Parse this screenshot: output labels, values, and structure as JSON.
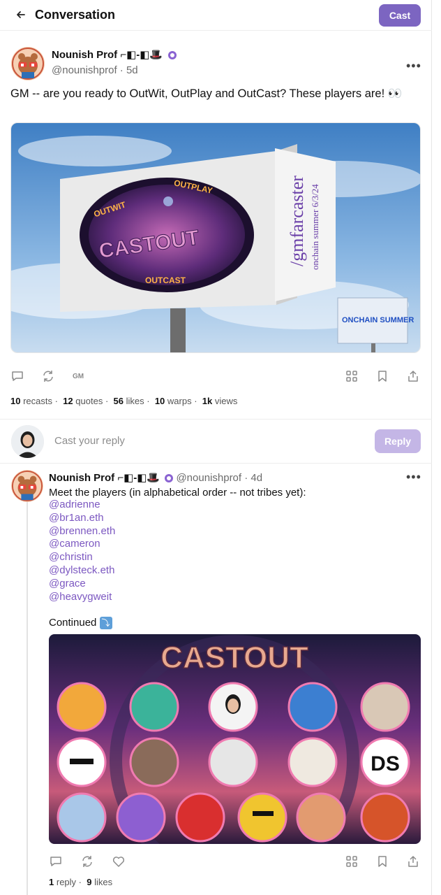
{
  "header": {
    "title": "Conversation",
    "cast_label": "Cast"
  },
  "cast": {
    "author": "Nounish Prof ⌐◧-◧🎩",
    "handle": "@nounishprof",
    "time": "5d",
    "text": "GM -- are you ready to OutWit, OutPlay and OutCast? These players are! 👀",
    "image": {
      "ellipse_words": [
        "OUTWIT",
        "OUTPLAY",
        "CASTOUT",
        "OUTCAST"
      ],
      "side_text": "/gmfarcaster",
      "side_subtext": "onchain summer 6/3/24",
      "small_billboard_text": "ONCHAIN SUMMER"
    },
    "gm_label": "GM",
    "stats": [
      {
        "value": "10",
        "label": "recasts"
      },
      {
        "value": "12",
        "label": "quotes"
      },
      {
        "value": "56",
        "label": "likes"
      },
      {
        "value": "10",
        "label": "warps"
      },
      {
        "value": "1k",
        "label": "views"
      }
    ]
  },
  "reply_box": {
    "placeholder": "Cast your reply",
    "button": "Reply"
  },
  "reply": {
    "author": "Nounish Prof ⌐◧-◧🎩",
    "handle": "@nounishprof",
    "time": "4d",
    "text": "Meet the players (in alphabetical order -- not tribes yet):",
    "mentions": [
      "@adrienne",
      "@br1an.eth",
      "@brennen.eth",
      "@cameron",
      "@christin",
      "@dylsteck.eth",
      "@grace",
      "@heavygweit"
    ],
    "continued": "Continued",
    "image_title": "CASTOUT",
    "stats": [
      {
        "value": "1",
        "label": "reply"
      },
      {
        "value": "9",
        "label": "likes"
      }
    ]
  }
}
